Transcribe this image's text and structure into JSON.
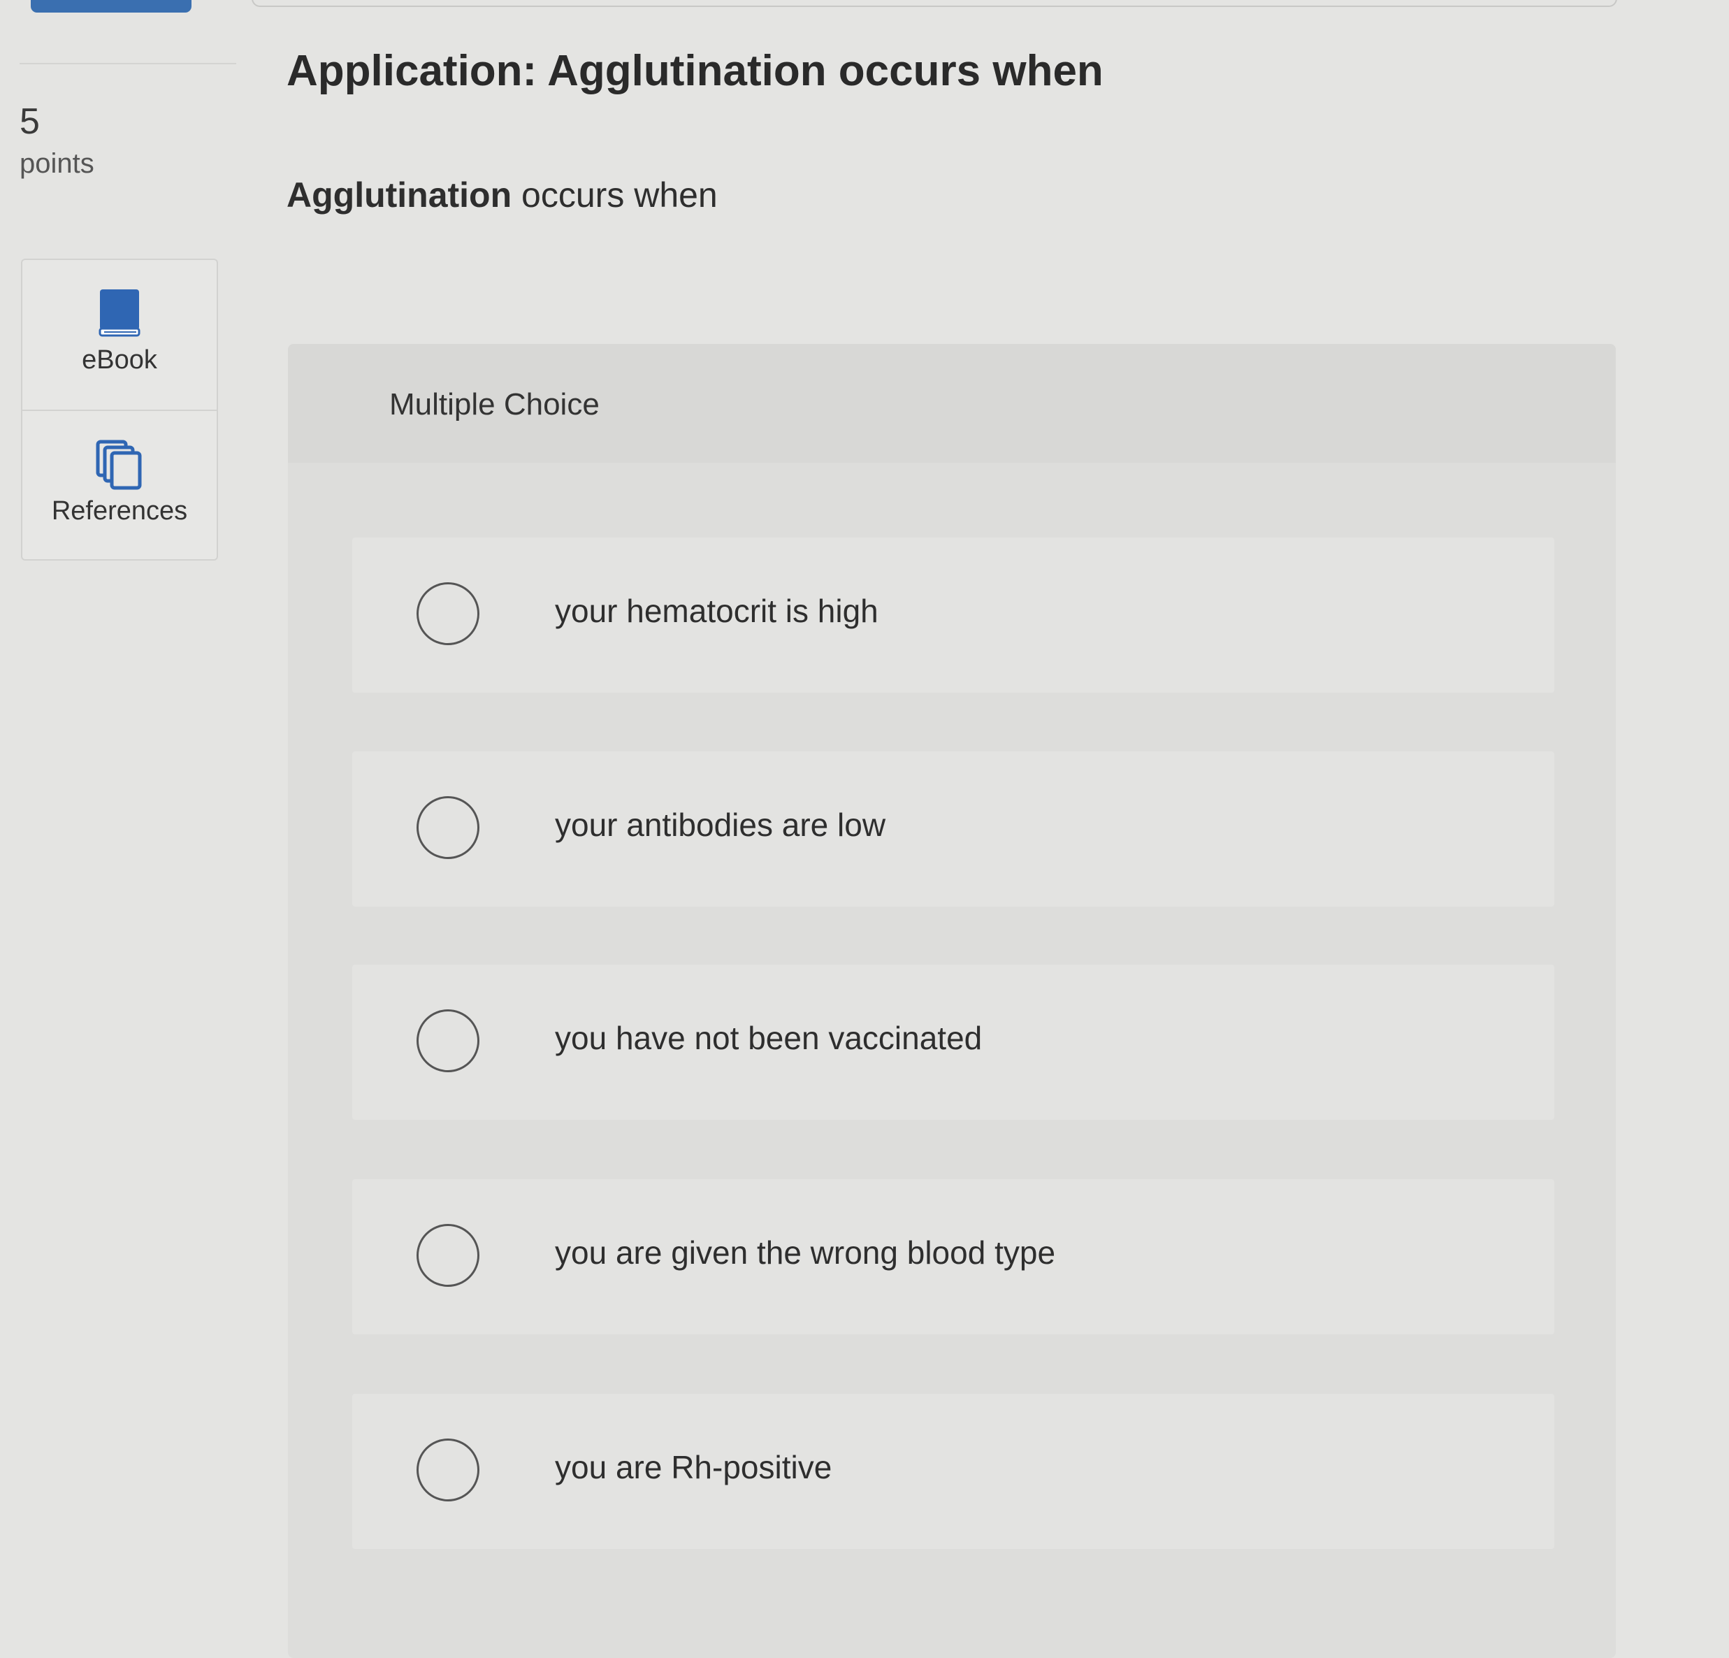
{
  "points": {
    "value": "5",
    "label": "points"
  },
  "tools": {
    "ebook_label": "eBook",
    "references_label": "References"
  },
  "question": {
    "title": "Application: Agglutination occurs when",
    "prompt_strong": "Agglutination",
    "prompt_rest": " occurs when"
  },
  "multiple_choice": {
    "label": "Multiple Choice",
    "options": [
      {
        "text": "your hematocrit is high"
      },
      {
        "text": "your antibodies are low"
      },
      {
        "text": "you have not been vaccinated"
      },
      {
        "text": "you are given the wrong blood type"
      },
      {
        "text": "you are Rh-positive"
      }
    ]
  },
  "colors": {
    "accent": "#3a6fb0",
    "background": "#e4e4e2"
  },
  "icons": [
    "book-icon",
    "copy-icon",
    "radio-icon"
  ]
}
